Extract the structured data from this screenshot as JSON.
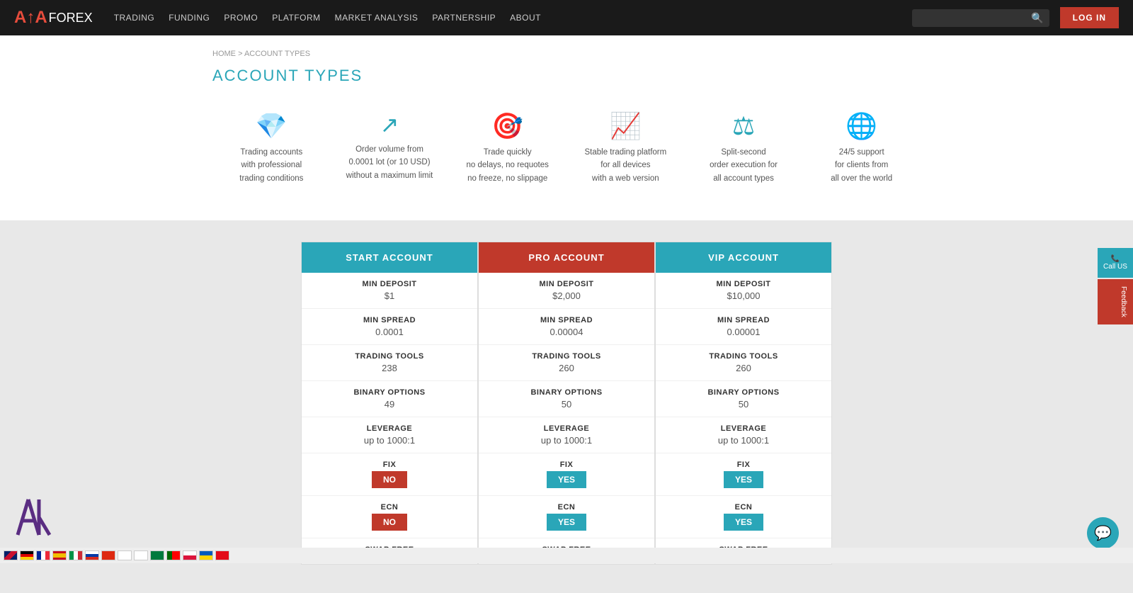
{
  "nav": {
    "logo_ata": "A↑A",
    "logo_forex": "FOREX",
    "links": [
      "TRADING",
      "FUNDING",
      "PROMO",
      "PLATFORM",
      "MARKET ANALYSIS",
      "PARTNERSHIP",
      "ABOUT"
    ],
    "search_placeholder": "",
    "login_label": "LOG IN"
  },
  "breadcrumb": {
    "home": "HOME",
    "sep": ">",
    "current": "ACCOUNT TYPES"
  },
  "page_title": "ACCOUNT TYPES",
  "features": [
    {
      "icon": "💎",
      "text": "Trading accounts\nwith professional\ntrading conditions"
    },
    {
      "icon": "↗",
      "text": "Order volume from\n0.0001 lot (or 10 USD)\nwithout a maximum limit"
    },
    {
      "icon": "🎯",
      "text": "Trade quickly\nno delays, no requotes\nno freeze, no slippage"
    },
    {
      "icon": "📈",
      "text": "Stable trading platform\nfor all devices\nwith a web version"
    },
    {
      "icon": "⚖",
      "text": "Split-second\norder execution for\nall account types"
    },
    {
      "icon": "🌐",
      "text": "24/5 support\nfor clients from\nall over the world"
    }
  ],
  "accounts": [
    {
      "name": "START ACCOUNT",
      "header_class": "header-start",
      "min_deposit_label": "MIN DEPOSIT",
      "min_deposit_value": "$1",
      "min_spread_label": "MIN SPREAD",
      "min_spread_value": "0.0001",
      "trading_tools_label": "TRADING TOOLS",
      "trading_tools_value": "238",
      "binary_options_label": "BINARY OPTIONS",
      "binary_options_value": "49",
      "leverage_label": "LEVERAGE",
      "leverage_value": "up to 1000:1",
      "fix_label": "FIX",
      "fix_badge": "NO",
      "fix_badge_class": "badge-no",
      "ecn_label": "ECN",
      "ecn_badge": "NO",
      "ecn_badge_class": "badge-no",
      "swap_free_label": "SWAP FREE"
    },
    {
      "name": "PRO ACCOUNT",
      "header_class": "header-pro",
      "min_deposit_label": "MIN DEPOSIT",
      "min_deposit_value": "$2,000",
      "min_spread_label": "MIN SPREAD",
      "min_spread_value": "0.00004",
      "trading_tools_label": "TRADING TOOLS",
      "trading_tools_value": "260",
      "binary_options_label": "BINARY OPTIONS",
      "binary_options_value": "50",
      "leverage_label": "LEVERAGE",
      "leverage_value": "up to 1000:1",
      "fix_label": "FIX",
      "fix_badge": "YES",
      "fix_badge_class": "badge-yes",
      "ecn_label": "ECN",
      "ecn_badge": "YES",
      "ecn_badge_class": "badge-yes",
      "swap_free_label": "SWAP FREE"
    },
    {
      "name": "VIP ACCOUNT",
      "header_class": "header-vip",
      "min_deposit_label": "MIN DEPOSIT",
      "min_deposit_value": "$10,000",
      "min_spread_label": "MIN SPREAD",
      "min_spread_value": "0.00001",
      "trading_tools_label": "TRADING TOOLS",
      "trading_tools_value": "260",
      "binary_options_label": "BINARY OPTIONS",
      "binary_options_value": "50",
      "leverage_label": "LEVERAGE",
      "leverage_value": "up to 1000:1",
      "fix_label": "FIX",
      "fix_badge": "YES",
      "fix_badge_class": "badge-yes",
      "ecn_label": "ECN",
      "ecn_badge": "YES",
      "ecn_badge_class": "badge-yes",
      "swap_free_label": "SWAP FREE"
    }
  ],
  "sidebar": {
    "call_icon": "📞",
    "call_label": "Call US",
    "feedback_label": "Feedback"
  },
  "chat": {
    "icon": "💬"
  }
}
